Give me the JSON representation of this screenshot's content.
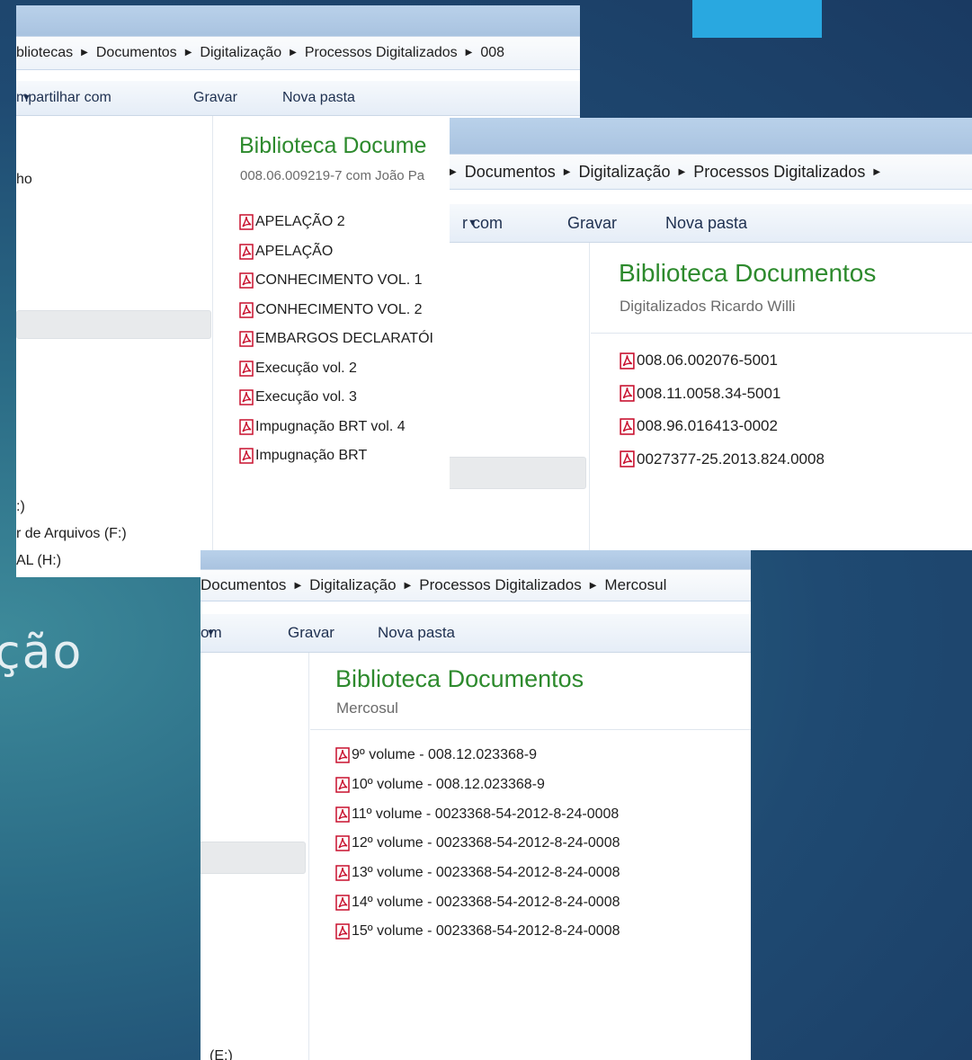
{
  "slide": {
    "partial_title": "ção"
  },
  "window1": {
    "breadcrumb": [
      "bliotecas",
      "Documentos",
      "Digitalização",
      "Processos Digitalizados",
      "008"
    ],
    "toolbar": {
      "share": "mpartilhar com",
      "burn": "Gravar",
      "new_folder": "Nova pasta"
    },
    "nav": {
      "item_top": "ho",
      "drive_1": ":)",
      "drive_2": "r de Arquivos (F:)",
      "drive_3": "AL (H:)"
    },
    "library_title": "Biblioteca Docume",
    "library_subtitle": "008.06.009219-7 com João Pa",
    "files": [
      "APELAÇÃO 2",
      "APELAÇÃO",
      "CONHECIMENTO VOL. 1",
      "CONHECIMENTO VOL. 2",
      "EMBARGOS DECLARATÓI",
      "Execução vol. 2",
      "Execução vol. 3",
      "Impugnação BRT vol. 4",
      "Impugnação BRT"
    ]
  },
  "window2": {
    "breadcrumb": [
      "Documentos",
      "Digitalização",
      "Processos Digitalizados"
    ],
    "toolbar": {
      "share": "r com",
      "burn": "Gravar",
      "new_folder": "Nova pasta"
    },
    "library_title": "Biblioteca Documentos",
    "library_subtitle": "Digitalizados Ricardo Willi",
    "files": [
      "008.06.002076-5001",
      "008.11.0058.34-5001",
      "008.96.016413-0002",
      "0027377-25.2013.824.0008"
    ]
  },
  "window3": {
    "breadcrumb": [
      "Documentos",
      "Digitalização",
      "Processos Digitalizados",
      "Mercosul"
    ],
    "toolbar": {
      "share": "om",
      "burn": "Gravar",
      "new_folder": "Nova pasta"
    },
    "nav": {
      "item_bottom": "(E:)"
    },
    "library_title": "Biblioteca Documentos",
    "library_subtitle": "Mercosul",
    "files": [
      "9º volume - 008.12.023368-9",
      "10º volume - 008.12.023368-9",
      "11º volume - 0023368-54-2012-8-24-0008",
      "12º volume - 0023368-54-2012-8-24-0008",
      "13º volume - 0023368-54-2012-8-24-0008",
      "14º volume - 0023368-54-2012-8-24-0008",
      "15º volume - 0023368-54-2012-8-24-0008"
    ]
  },
  "colors": {
    "accent": "#29a8e0",
    "library_title": "#2d8a2d",
    "pdf_red": "#c8102e"
  }
}
